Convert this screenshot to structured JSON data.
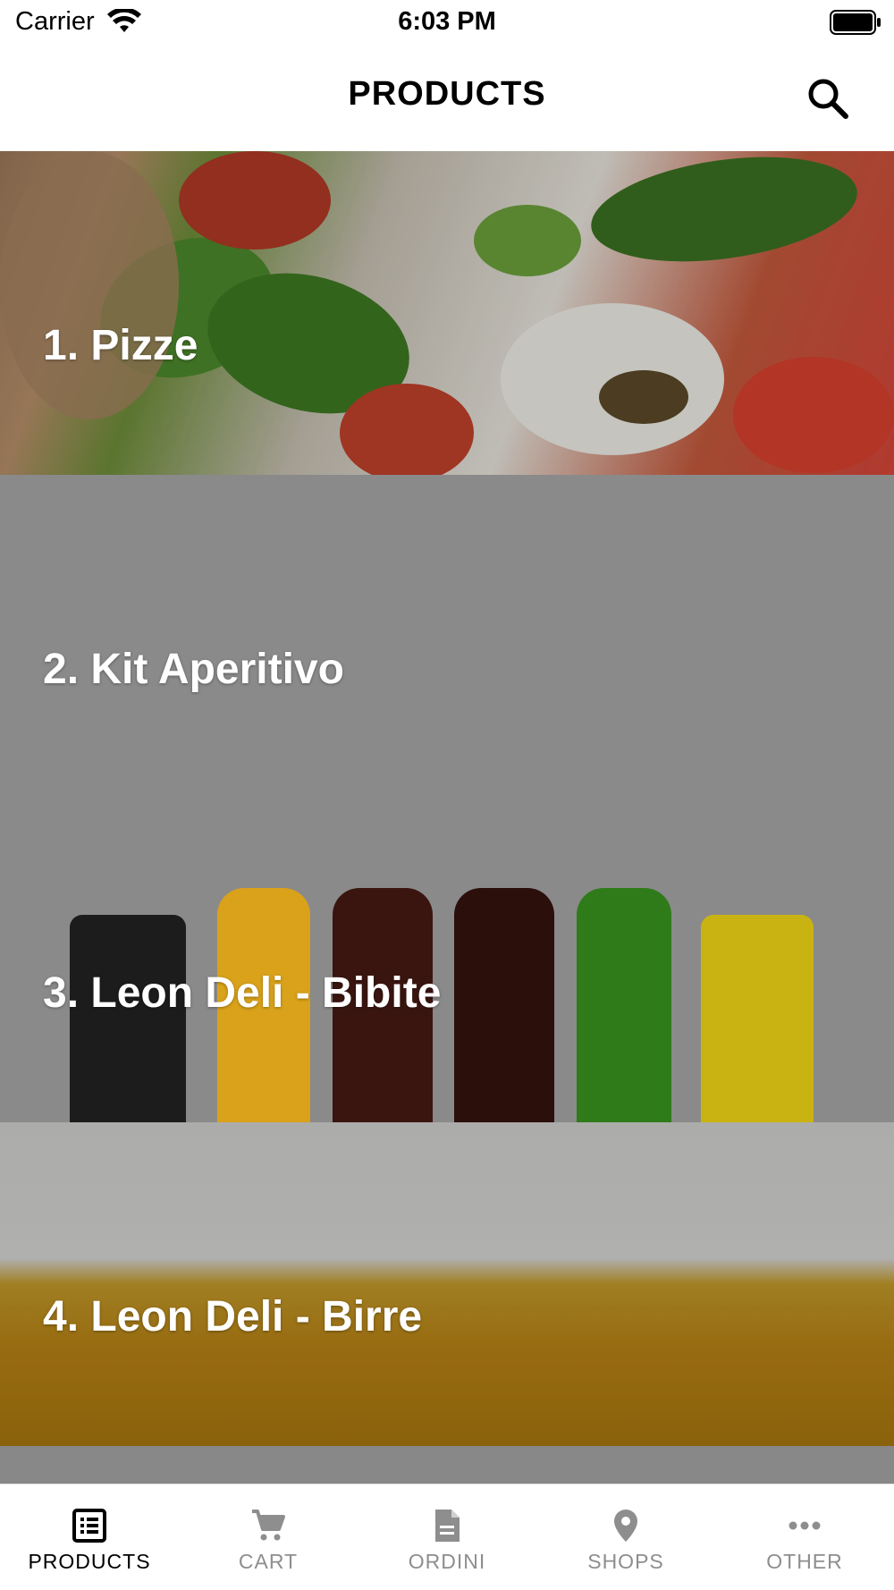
{
  "status_bar": {
    "carrier": "Carrier",
    "time": "6:03 PM"
  },
  "header": {
    "title": "PRODUCTS",
    "search_icon": "search-icon"
  },
  "categories": [
    {
      "label": "1. Pizze"
    },
    {
      "label": "2. Kit Aperitivo"
    },
    {
      "label": "3. Leon Deli - Bibite"
    },
    {
      "label": "4. Leon Deli - Birre"
    }
  ],
  "tabs": [
    {
      "label": "PRODUCTS",
      "icon": "list-icon",
      "active": true
    },
    {
      "label": "CART",
      "icon": "cart-icon",
      "active": false
    },
    {
      "label": "ORDINI",
      "icon": "document-icon",
      "active": false
    },
    {
      "label": "SHOPS",
      "icon": "location-pin-icon",
      "active": false
    },
    {
      "label": "OTHER",
      "icon": "more-icon",
      "active": false
    }
  ],
  "colors": {
    "active_tab": "#000000",
    "inactive_tab": "#8e8e8e",
    "category_label": "#ffffff"
  }
}
